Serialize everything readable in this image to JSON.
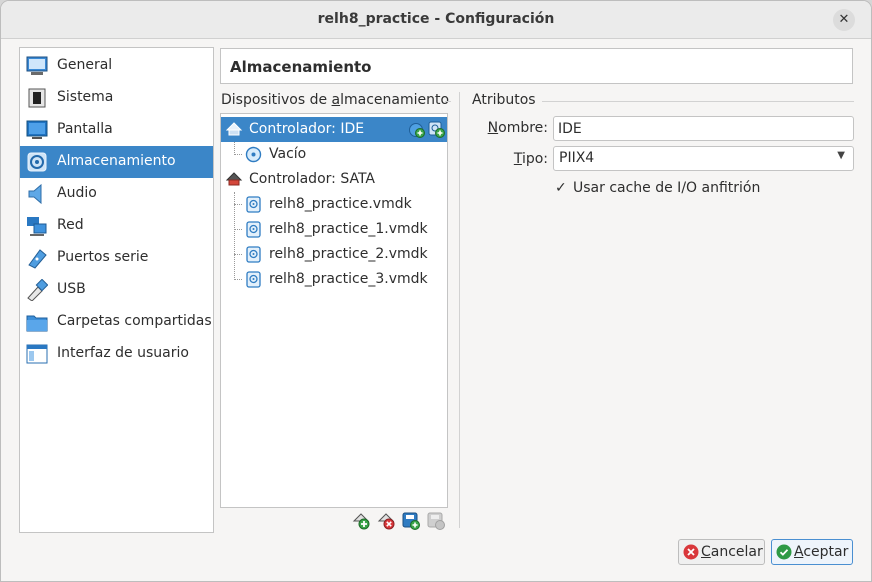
{
  "window": {
    "title": "relh8_practice - Configuración",
    "close_glyph": "✕"
  },
  "sidebar": {
    "items": [
      {
        "label": "General",
        "icon": "general-icon"
      },
      {
        "label": "Sistema",
        "icon": "system-chip-icon"
      },
      {
        "label": "Pantalla",
        "icon": "display-monitor-icon"
      },
      {
        "label": "Almacenamiento",
        "icon": "storage-disk-icon",
        "selected": true
      },
      {
        "label": "Audio",
        "icon": "audio-speaker-icon"
      },
      {
        "label": "Red",
        "icon": "network-icon"
      },
      {
        "label": "Puertos serie",
        "icon": "serial-port-icon"
      },
      {
        "label": "USB",
        "icon": "usb-icon"
      },
      {
        "label": "Carpetas compartidas",
        "icon": "shared-folder-icon"
      },
      {
        "label": "Interfaz de usuario",
        "icon": "user-interface-icon"
      }
    ]
  },
  "page": {
    "title": "Almacenamiento"
  },
  "storage": {
    "label_pre": "Dispositivos de ",
    "label_key": "a",
    "label_post": "lmacenamiento",
    "tree": [
      {
        "label": "Controlador: IDE",
        "type": "controller-ide",
        "selected": true
      },
      {
        "label": "Vacío",
        "type": "optical-empty"
      },
      {
        "label": "Controlador: SATA",
        "type": "controller-sata"
      },
      {
        "label": "relh8_practice.vmdk",
        "type": "disk"
      },
      {
        "label": "relh8_practice_1.vmdk",
        "type": "disk"
      },
      {
        "label": "relh8_practice_2.vmdk",
        "type": "disk"
      },
      {
        "label": "relh8_practice_3.vmdk",
        "type": "disk"
      }
    ],
    "toolbar": [
      "add-controller-icon",
      "remove-controller-icon",
      "add-attachment-icon",
      "remove-attachment-icon"
    ]
  },
  "attributes": {
    "title": "Atributos",
    "name_key": "N",
    "name_label_rest": "ombre:",
    "name_value": "IDE",
    "type_key": "T",
    "type_label_rest": "ipo:",
    "type_value": "PIIX4",
    "use_cache_label": "Usar cache de I/O anfitrión",
    "use_cache_checked": true
  },
  "buttons": {
    "cancel_key": "C",
    "cancel_rest": "ancelar",
    "accept_key": "A",
    "accept_rest": "ceptar"
  },
  "colors": {
    "selection": "#3b86c8",
    "cancel_icon": "#d9373b",
    "accept_icon": "#2e9a45"
  }
}
